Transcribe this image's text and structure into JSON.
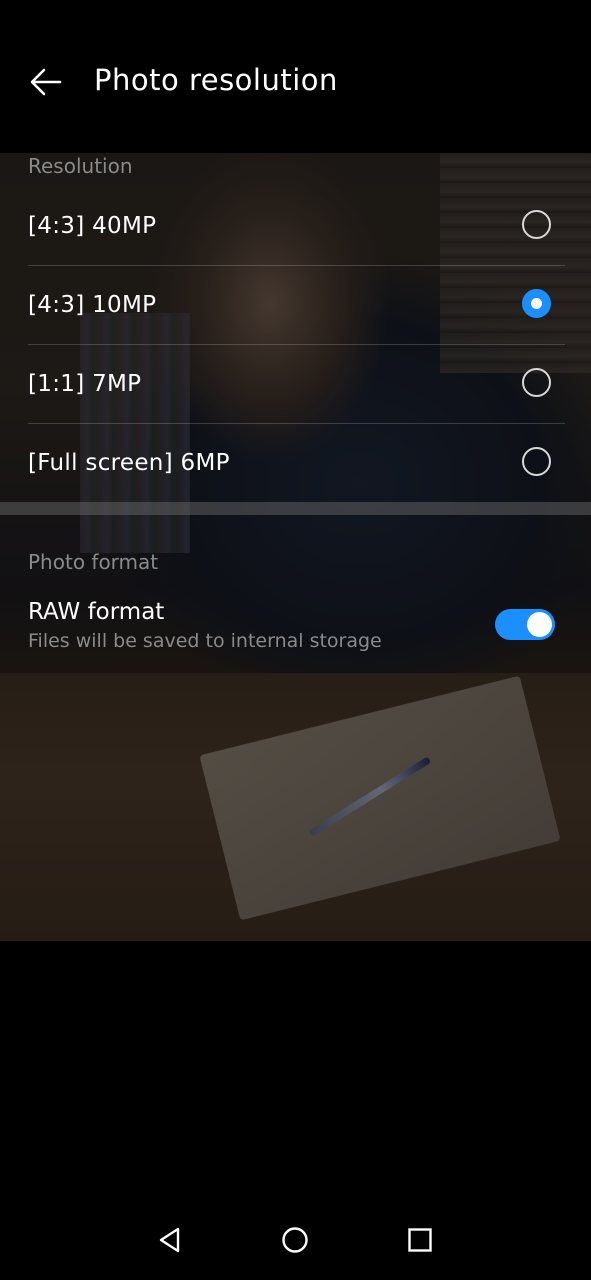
{
  "header": {
    "title": "Photo resolution",
    "back_icon": "arrow-left-icon"
  },
  "resolution": {
    "label": "Resolution",
    "options": [
      {
        "label": "[4:3] 40MP",
        "selected": false
      },
      {
        "label": "[4:3] 10MP",
        "selected": true
      },
      {
        "label": "[1:1] 7MP",
        "selected": false
      },
      {
        "label": "[Full screen] 6MP",
        "selected": false
      }
    ]
  },
  "photo_format": {
    "label": "Photo format",
    "raw": {
      "title": "RAW format",
      "subtitle": "Files will be saved to internal storage",
      "enabled": true
    }
  },
  "nav": {
    "back_icon": "triangle-back-icon",
    "home_icon": "circle-home-icon",
    "recents_icon": "square-recents-icon"
  },
  "colors": {
    "accent": "#1c8fff",
    "background": "#000000",
    "secondary_text": "#8a8a8a"
  }
}
